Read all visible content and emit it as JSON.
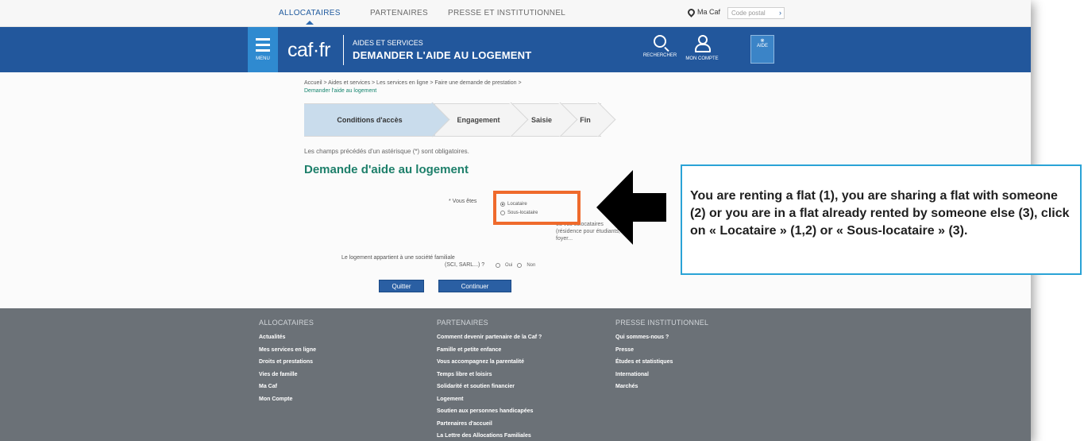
{
  "topnav": {
    "items": [
      "ALLOCATAIRES",
      "PARTENAIRES",
      "PRESSE ET INSTITUTIONNEL"
    ],
    "ma_caf": "Ma Caf",
    "postal_placeholder": "Code postal",
    "go": "›"
  },
  "header": {
    "menu_label": "MENU",
    "logo": "caf·fr",
    "kicker": "AIDES ET SERVICES",
    "title": "DEMANDER L'AIDE AU LOGEMENT",
    "search_label": "RECHERCHER",
    "account_label": "MON COMPTE",
    "help_label": "AIDE"
  },
  "breadcrumb": {
    "path": "Accueil > Aides et services > Les services en ligne > Faire une demande de prestation >",
    "current": "Demander l'aide au logement"
  },
  "stepper": {
    "steps": [
      "Conditions d'accès",
      "Engagement",
      "Saisie",
      "Fin"
    ]
  },
  "form": {
    "mandatory_note": "Les champs précédés d'un astérisque (*) sont obligatoires.",
    "title": "Demande d'aide au logement",
    "vous_etes": "* Vous êtes",
    "options": [
      "Locataire",
      "Sous-locataire"
    ],
    "note": "ou vos colocataires (résidence pour étudiants, foyer...",
    "societe_question": "Le logement appartient à une société familiale",
    "societe_question_2": "(SCI, SARL...) ?",
    "oui": "Oui",
    "non": "Non",
    "quit_button": "Quitter",
    "continue_button": "Continuer"
  },
  "footer": {
    "columns": [
      {
        "heading": "ALLOCATAIRES",
        "items": [
          "Actualités",
          "Mes services en ligne",
          "Droits et prestations",
          "Vies de famille",
          "Ma Caf",
          "Mon Compte"
        ]
      },
      {
        "heading": "PARTENAIRES",
        "items": [
          "Comment devenir partenaire de la Caf ?",
          "Famille et petite enfance",
          "Vous accompagnez la parentalité",
          "Temps libre et loisirs",
          "Solidarité et soutien financier",
          "Logement",
          "Soutien aux personnes handicapées",
          "Partenaires d'accueil",
          "La Lettre des Allocations Familiales"
        ]
      },
      {
        "heading": "PRESSE INSTITUTIONNEL",
        "items": [
          "Qui sommes-nous ?",
          "Presse",
          "Études et statistiques",
          "International",
          "Marchés"
        ]
      }
    ]
  },
  "callout": {
    "text": "You are renting a flat (1), you are sharing a flat with someone (2) or you are in a flat already rented by someone else (3), click on « Locataire » (1,2) or « Sous-locataire » (3)."
  },
  "colors": {
    "header_blue": "#22579c",
    "teal_title": "#1d7f6a",
    "highlight_orange": "#ef6a2c",
    "callout_border": "#2aa3d6",
    "footer_grey": "#6b7177"
  }
}
